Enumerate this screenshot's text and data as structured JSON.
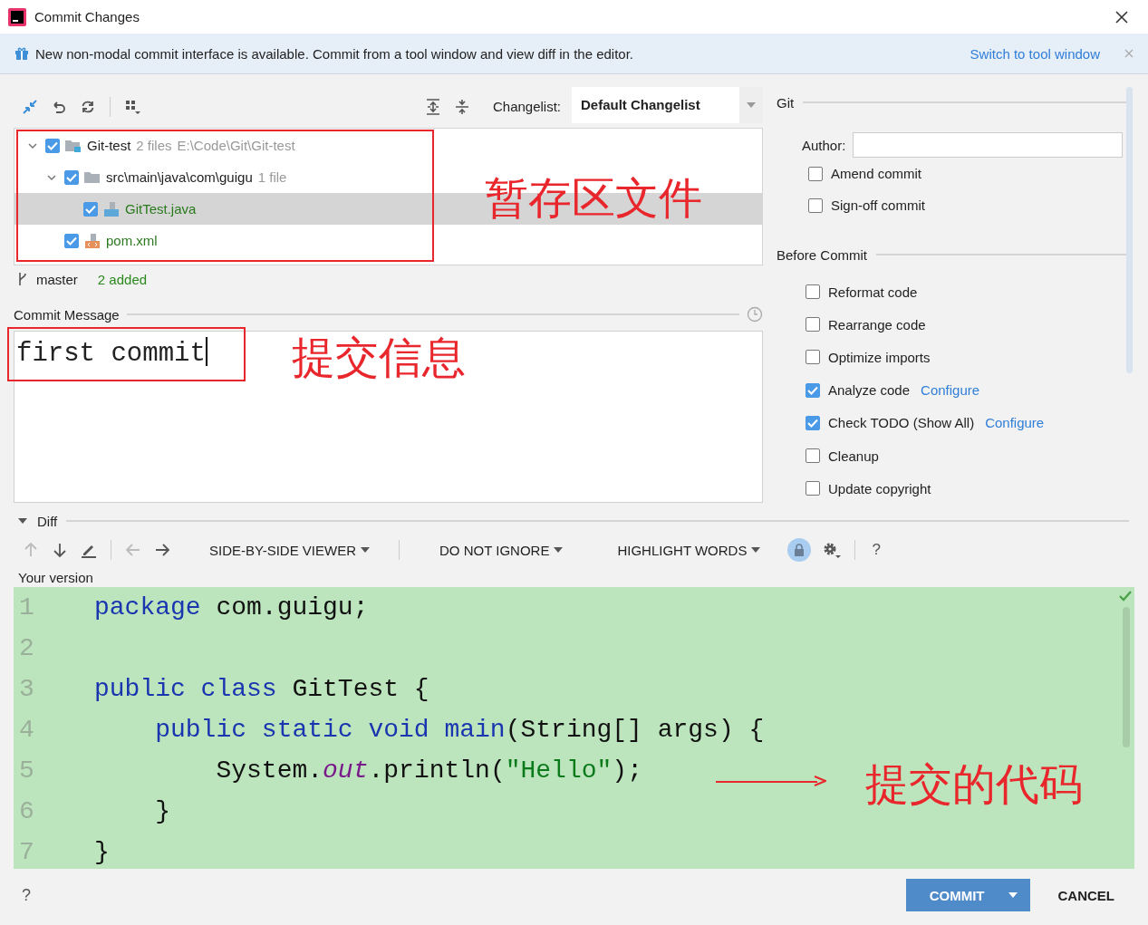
{
  "window": {
    "title": "Commit Changes"
  },
  "banner": {
    "message": "New non-modal commit interface is available. Commit from a tool window and view diff in the editor.",
    "link": "Switch to tool window"
  },
  "changes_toolbar": {
    "changelist_label": "Changelist:",
    "changelist": "Default Changelist"
  },
  "tree": [
    {
      "kind": "module",
      "name": "Git-test",
      "count": "2 files",
      "path": "E:\\Code\\Git\\Git-test",
      "checked": true,
      "expanded": true,
      "selected": false,
      "children": [
        {
          "kind": "folder",
          "name": "src\\main\\java\\com\\guigu",
          "count": "1 file",
          "checked": true,
          "expanded": true,
          "selected": false,
          "children": [
            {
              "kind": "java",
              "name": "GitTest.java",
              "checked": true,
              "selected": true
            }
          ]
        },
        {
          "kind": "xml",
          "name": "pom.xml",
          "checked": true,
          "selected": false
        }
      ]
    }
  ],
  "branch": {
    "name": "master",
    "summary": "2 added"
  },
  "commit_message": {
    "label": "Commit Message",
    "value": "first commit"
  },
  "git": {
    "title": "Git",
    "author_label": "Author:",
    "options": [
      {
        "label": "Amend commit",
        "checked": false
      },
      {
        "label": "Sign-off commit",
        "checked": false
      }
    ]
  },
  "before_commit": {
    "title": "Before Commit",
    "options": [
      {
        "label": "Reformat code",
        "checked": false
      },
      {
        "label": "Rearrange code",
        "checked": false
      },
      {
        "label": "Optimize imports",
        "checked": false
      },
      {
        "label": "Analyze code",
        "checked": true,
        "link": "Configure"
      },
      {
        "label": "Check TODO (Show All)",
        "checked": true,
        "link": "Configure"
      },
      {
        "label": "Cleanup",
        "checked": false
      },
      {
        "label": "Update copyright",
        "checked": false
      }
    ]
  },
  "diff": {
    "title": "Diff",
    "expanded": true,
    "toolbar": [
      {
        "kind": "up",
        "disabled": true
      },
      {
        "kind": "down",
        "disabled": false
      },
      {
        "kind": "edit",
        "disabled": false
      },
      {
        "kind": "separator"
      },
      {
        "kind": "left",
        "disabled": true
      },
      {
        "kind": "right",
        "disabled": false
      },
      {
        "kind": "dropdown",
        "label": "SIDE-BY-SIDE VIEWER"
      },
      {
        "kind": "separator"
      },
      {
        "kind": "dropdown",
        "label": "DO NOT IGNORE"
      },
      {
        "kind": "dropdown",
        "label": "HIGHLIGHT WORDS"
      },
      {
        "kind": "lock",
        "on": true
      },
      {
        "kind": "settings"
      },
      {
        "kind": "separator"
      },
      {
        "kind": "help",
        "label": "?"
      }
    ],
    "caption": "Your version",
    "lines": [
      {
        "number": "1",
        "segments": [
          {
            "kind": "keyword",
            "text": "package"
          },
          {
            "kind": "plain",
            "text": " com.guigu;"
          }
        ]
      },
      {
        "number": "2"
      },
      {
        "number": "3",
        "segments": [
          {
            "kind": "keyword",
            "text": "public class"
          },
          {
            "kind": "plain",
            "text": " GitTest {"
          }
        ]
      },
      {
        "number": "4",
        "segments": [
          {
            "kind": "keyword",
            "text": "    public static void main"
          },
          {
            "kind": "plain",
            "text": "(String[] args) {"
          }
        ]
      },
      {
        "number": "5",
        "segments": [
          {
            "kind": "plain",
            "text": "        System."
          },
          {
            "kind": "field",
            "text": "out"
          },
          {
            "kind": "plain",
            "text": ".println("
          },
          {
            "kind": "string",
            "text": "\"Hello\""
          },
          {
            "kind": "plain",
            "text": ");"
          }
        ]
      },
      {
        "number": "6",
        "segments": [
          {
            "kind": "plain",
            "text": "    }"
          }
        ]
      },
      {
        "number": "7",
        "segments": [
          {
            "kind": "plain",
            "text": "}"
          }
        ]
      }
    ]
  },
  "footer": {
    "help": "?",
    "commit": "COMMIT",
    "cancel": "CANCEL"
  },
  "annotations": {
    "tree": "暂存区文件",
    "message": "提交信息",
    "code": "提交的代码"
  }
}
